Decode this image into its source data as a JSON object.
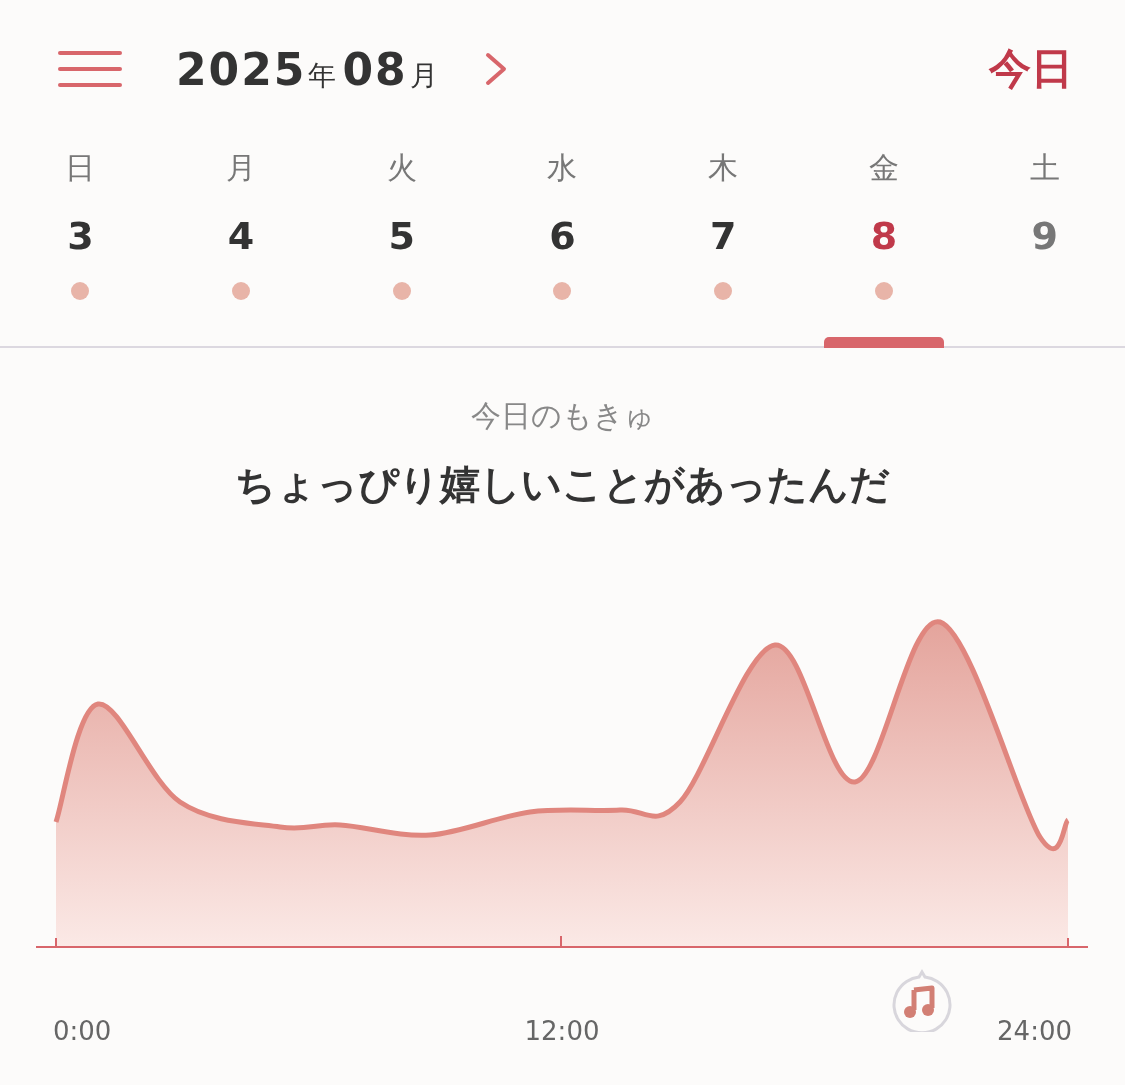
{
  "header": {
    "year": "2025",
    "year_unit": "年",
    "month": "08",
    "month_unit": "月",
    "today_button": "今日"
  },
  "week": [
    {
      "weekday": "日",
      "day": "3",
      "selected": false,
      "has_entry": true,
      "future": false
    },
    {
      "weekday": "月",
      "day": "4",
      "selected": false,
      "has_entry": true,
      "future": false
    },
    {
      "weekday": "火",
      "day": "5",
      "selected": false,
      "has_entry": true,
      "future": false
    },
    {
      "weekday": "水",
      "day": "6",
      "selected": false,
      "has_entry": true,
      "future": false
    },
    {
      "weekday": "木",
      "day": "7",
      "selected": false,
      "has_entry": true,
      "future": false
    },
    {
      "weekday": "金",
      "day": "8",
      "selected": true,
      "has_entry": true,
      "future": false
    },
    {
      "weekday": "土",
      "day": "9",
      "selected": false,
      "has_entry": false,
      "future": true
    }
  ],
  "mood": {
    "subtitle": "今日のもきゅ",
    "headline": "ちょっぴり嬉しいことがあったんだ"
  },
  "timeline": {
    "labels": [
      "0:00",
      "12:00",
      "24:00"
    ]
  }
}
